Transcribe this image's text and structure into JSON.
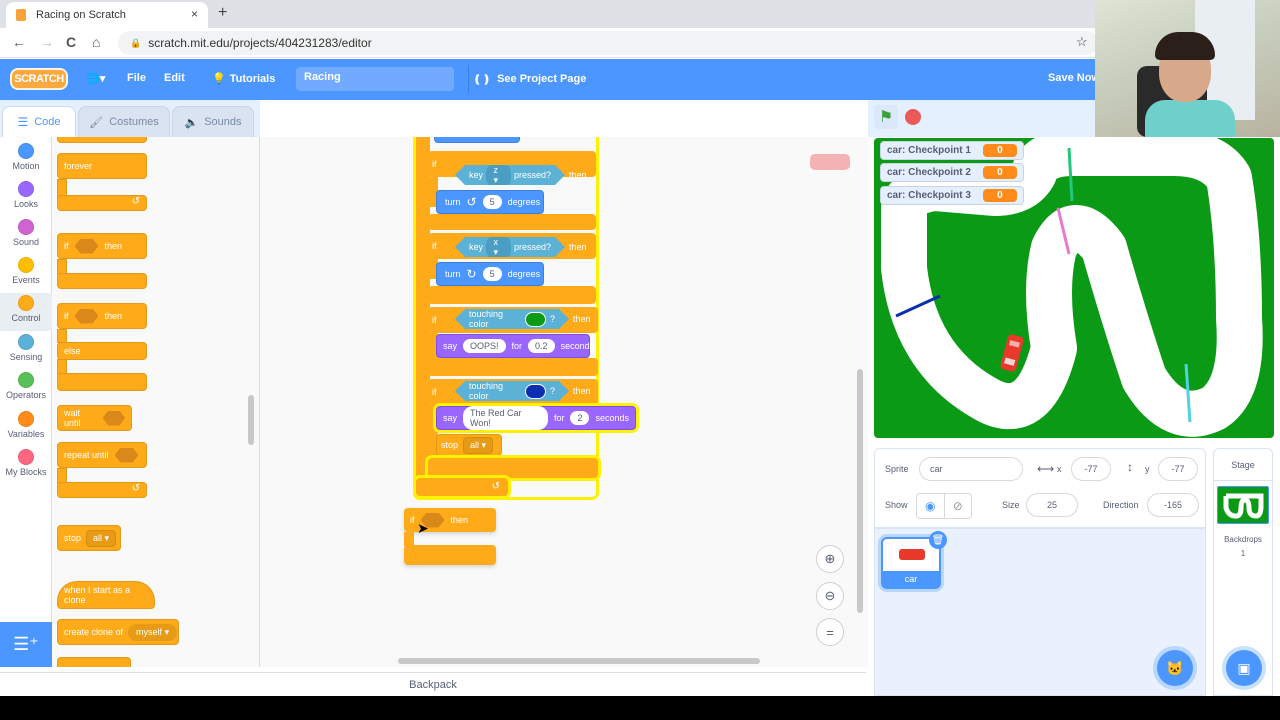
{
  "browser": {
    "tab_title": "Racing on Scratch",
    "tab_close": "×",
    "new_tab": "+",
    "url": "scratch.mit.edu/projects/404231283/editor",
    "back": "←",
    "forward": "→",
    "reload": "C",
    "home": "⌂",
    "bookmark": "☆"
  },
  "menubar": {
    "logo": "SCRATCH",
    "language_icon": "🌐▾",
    "file": "File",
    "edit": "Edit",
    "tutorials": "Tutorials",
    "project_title": "Racing",
    "see_project_page": "See Project Page",
    "save_now": "Save Now"
  },
  "editor_tabs": {
    "code": "Code",
    "costumes": "Costumes",
    "sounds": "Sounds"
  },
  "categories": [
    {
      "label": "Motion",
      "color": "#4c97ff"
    },
    {
      "label": "Looks",
      "color": "#9966ff"
    },
    {
      "label": "Sound",
      "color": "#cf63cf"
    },
    {
      "label": "Events",
      "color": "#ffbf00"
    },
    {
      "label": "Control",
      "color": "#ffab19"
    },
    {
      "label": "Sensing",
      "color": "#5cb1d6"
    },
    {
      "label": "Operators",
      "color": "#59c059"
    },
    {
      "label": "Variables",
      "color": "#ff8c1a"
    },
    {
      "label": "My Blocks",
      "color": "#ff6680"
    }
  ],
  "palette": {
    "forever": "forever",
    "if": "if",
    "then": "then",
    "else": "else",
    "wait_until": "wait until",
    "repeat_until": "repeat until",
    "stop": "stop",
    "stop_option": "all",
    "when_clone": "when I start as a clone",
    "create_clone": "create clone of",
    "create_clone_option": "myself",
    "loop_arrow": "↺"
  },
  "script": {
    "if1": {
      "if": "if",
      "key": "key",
      "key_value": "z",
      "pressed": "pressed?",
      "then": "then",
      "turn": "turn",
      "turn_icon": "↺",
      "degrees_value": "5",
      "degrees": "degrees"
    },
    "if2": {
      "if": "if",
      "key": "key",
      "key_value": "x",
      "pressed": "pressed?",
      "then": "then",
      "turn": "turn",
      "turn_icon": "↻",
      "degrees_value": "5",
      "degrees": "degrees"
    },
    "if3": {
      "if": "if",
      "touching": "touching color",
      "q": "?",
      "then": "then",
      "color": "#0a9a15",
      "say": "say",
      "message": "OOPS!",
      "for": "for",
      "secs_value": "0.2",
      "seconds": "seconds"
    },
    "if4": {
      "if": "if",
      "touching": "touching color",
      "q": "?",
      "then": "then",
      "color": "#0a2fb0",
      "say": "say",
      "message": "The Red Car Won!",
      "for": "for",
      "secs_value": "2",
      "seconds": "seconds",
      "stop": "stop",
      "stop_option": "all"
    },
    "loop_arrow": "↺",
    "dragged": {
      "if": "if",
      "then": "then"
    }
  },
  "zoom_controls": {
    "zoom_in": "⊕",
    "zoom_out": "⊖",
    "reset": "="
  },
  "backpack": "Backpack",
  "stage": {
    "monitors": [
      {
        "label": "car: Checkpoint 1",
        "value": "0"
      },
      {
        "label": "car: Checkpoint 2",
        "value": "0"
      },
      {
        "label": "car: Checkpoint 3",
        "value": "0"
      }
    ]
  },
  "sprite_info": {
    "sprite_label": "Sprite",
    "sprite_name": "car",
    "x_label": "x",
    "x_value": "-77",
    "y_label": "y",
    "y_value": "-77",
    "show_label": "Show",
    "size_label": "Size",
    "size_value": "25",
    "direction_label": "Direction",
    "direction_value": "-165"
  },
  "sprites": [
    {
      "name": "car"
    }
  ],
  "stage_pane": {
    "title": "Stage",
    "backdrops_label": "Backdrops",
    "backdrops_count": "1"
  }
}
